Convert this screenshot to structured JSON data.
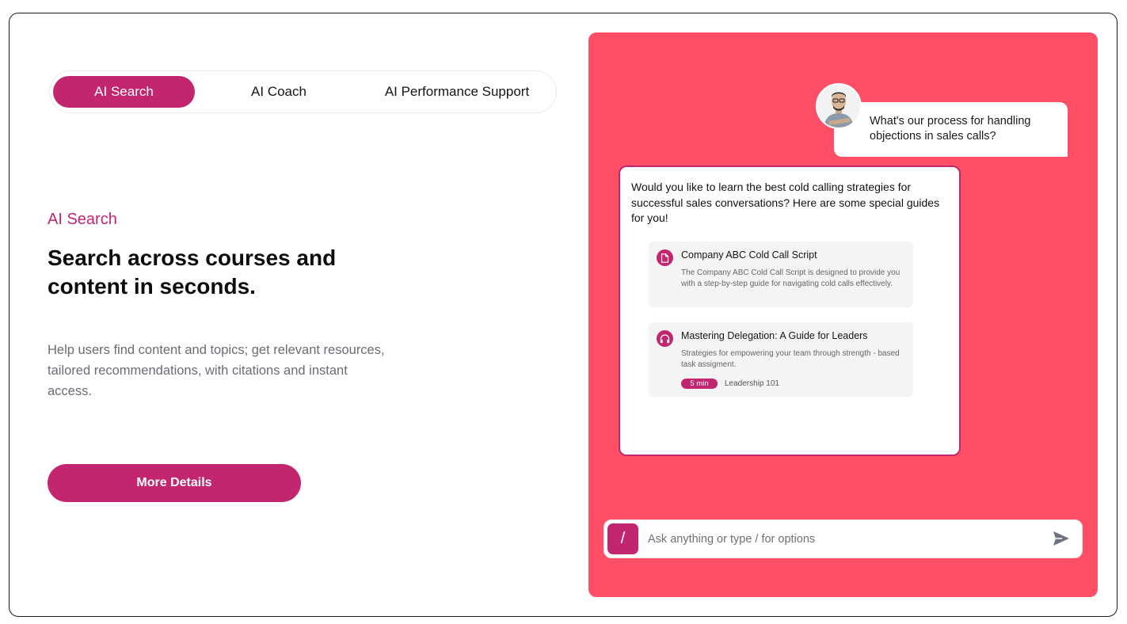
{
  "tabs": [
    {
      "label": "AI Search",
      "active": true
    },
    {
      "label": "AI Coach",
      "active": false
    },
    {
      "label": "AI Performance Support",
      "active": false
    }
  ],
  "section": {
    "eyebrow": "AI Search",
    "headline": "Search across courses and content in seconds.",
    "description": "Help users find content and topics; get relevant resources, tailored recommendations, with citations and instant access.",
    "cta_label": "More Details"
  },
  "chat": {
    "user_message": "What's our process for handling objections in sales calls?",
    "assistant_message": "Would you like to learn the best cold calling strategies for successful sales conversations? Here are some special guides for you!",
    "results": [
      {
        "icon": "document-icon",
        "title": "Company ABC Cold Call Script",
        "body": "The Company ABC Cold Call Script is designed to provide you with a step-by-step guide for navigating cold calls effectively."
      },
      {
        "icon": "headphones-icon",
        "title": "Mastering Delegation: A Guide for Leaders",
        "body": "Strategies for empowering your team through strength - based task assigment.",
        "duration": "5 min",
        "course": "Leadership 101"
      }
    ],
    "input": {
      "slash_label": "/",
      "placeholder": "Ask anything or type / for options"
    }
  },
  "colors": {
    "accent": "#c2266f",
    "panel": "#ff4f66"
  }
}
